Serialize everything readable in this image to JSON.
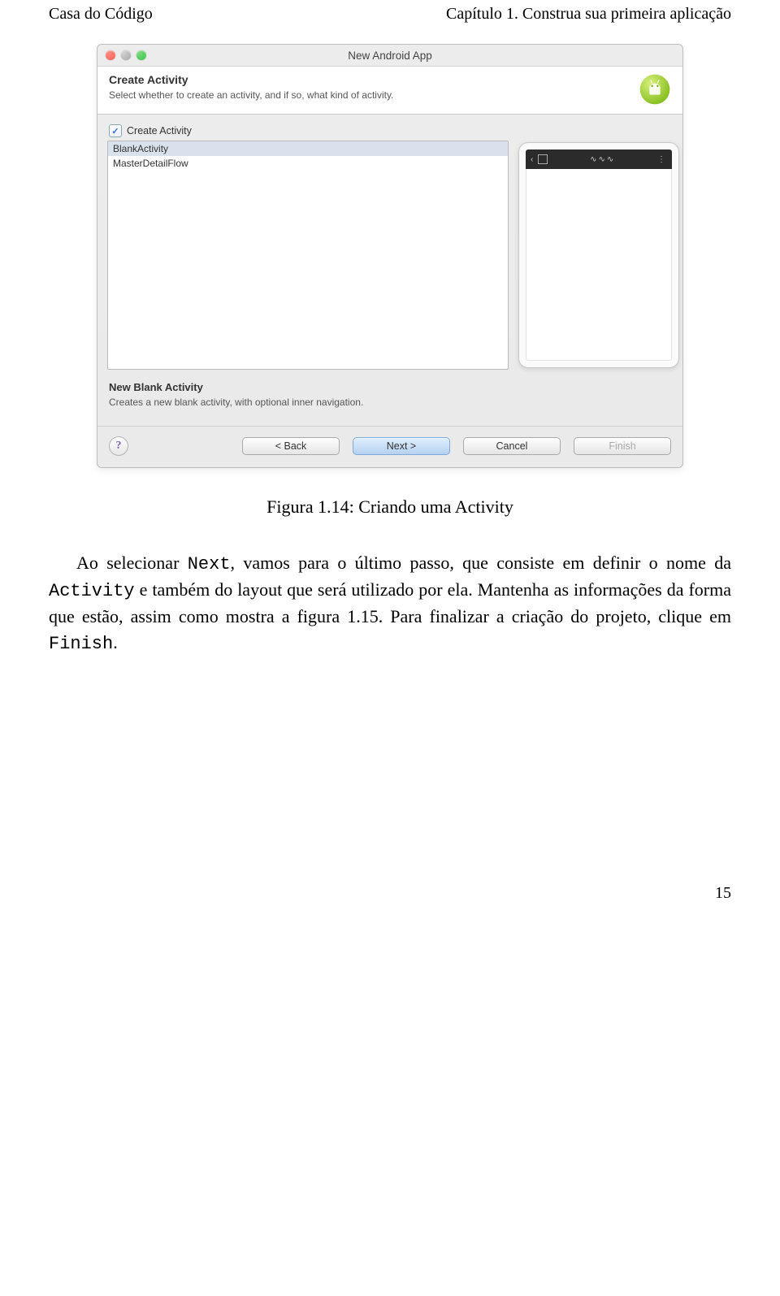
{
  "header": {
    "left": "Casa do Código",
    "right": "Capítulo 1. Construa sua primeira aplicação"
  },
  "dialog": {
    "title": "New Android App",
    "banner": {
      "heading": "Create Activity",
      "sub": "Select whether to create an activity, and if so, what kind of activity."
    },
    "checkbox_label": "Create Activity",
    "list": {
      "items": [
        "BlankActivity",
        "MasterDetailFlow"
      ],
      "selected_index": 0
    },
    "desc": {
      "heading": "New Blank Activity",
      "sub": "Creates a new blank activity, with optional inner navigation."
    },
    "buttons": {
      "back": "< Back",
      "next": "Next >",
      "cancel": "Cancel",
      "finish": "Finish"
    },
    "help_glyph": "?"
  },
  "caption": "Figura 1.14: Criando uma Activity",
  "body": {
    "p1_pre": "Ao selecionar ",
    "p1_code1": "Next",
    "p1_mid": ", vamos para o último passo, que consiste em definir o nome da ",
    "p1_code2": "Activity",
    "p1_post": " e também do layout que será utilizado por ela. Mantenha as informações da forma que estão, assim como mostra a figura 1.15. Para finalizar a criação do projeto, clique em ",
    "p1_code3": "Finish",
    "p1_end": "."
  },
  "page_number": "15"
}
